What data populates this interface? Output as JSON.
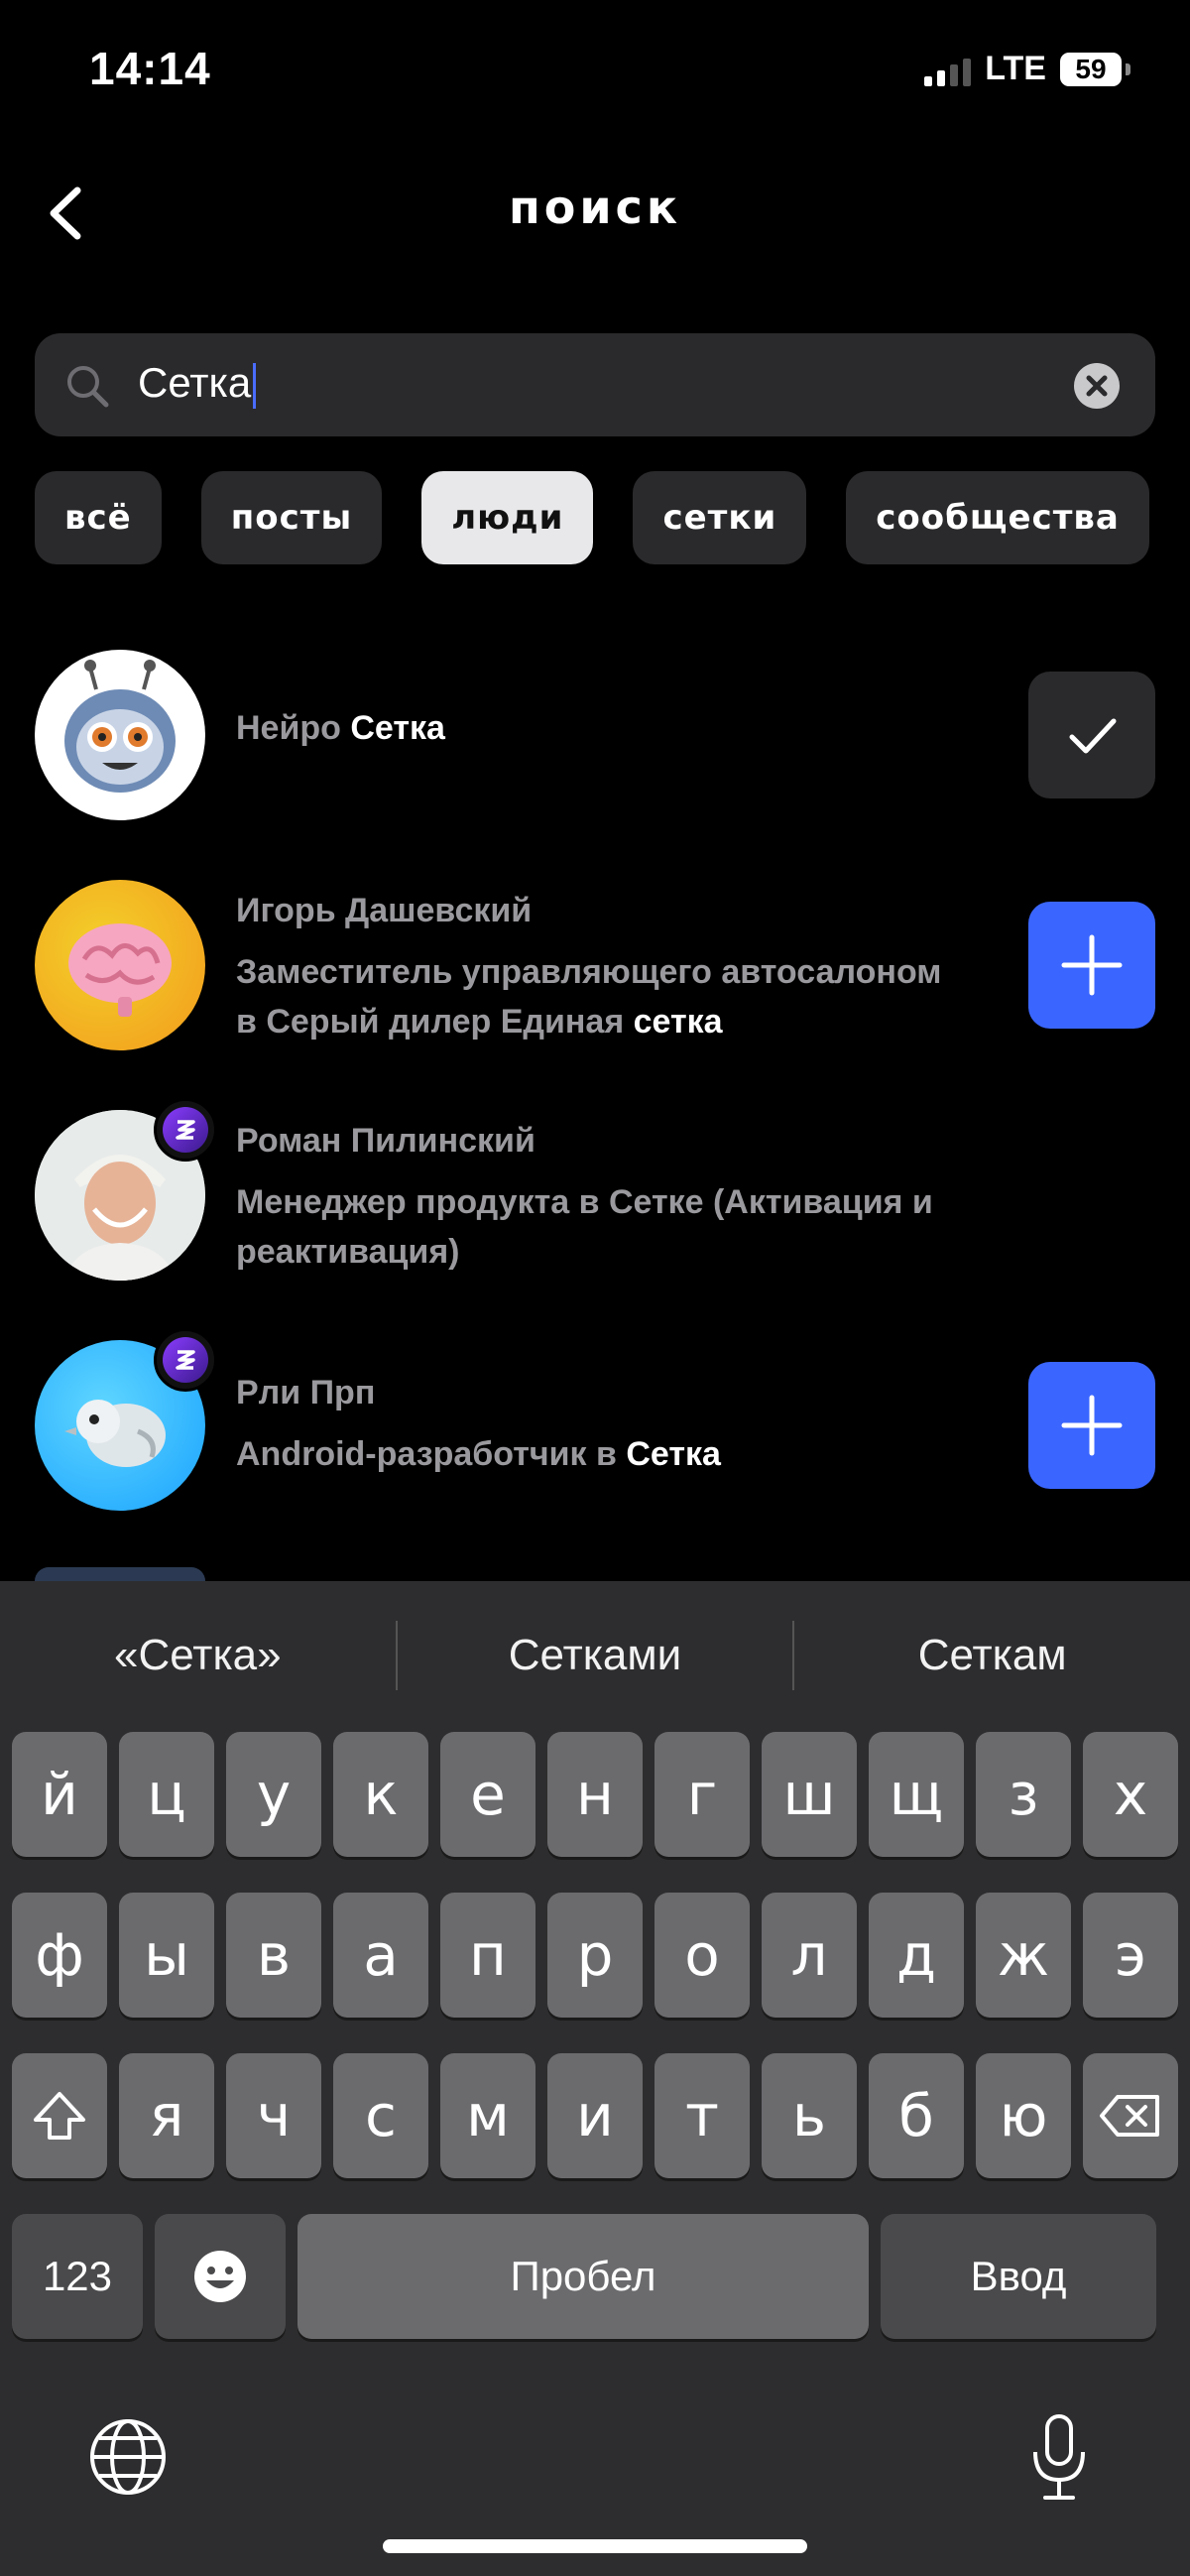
{
  "status_bar": {
    "time": "14:14",
    "network": "LTE",
    "battery": "59"
  },
  "header": {
    "title": "поиск"
  },
  "search": {
    "value": "Сетка"
  },
  "tabs": [
    {
      "label": "всё"
    },
    {
      "label": "посты"
    },
    {
      "label": "люди"
    },
    {
      "label": "сетки"
    },
    {
      "label": "сообщества"
    }
  ],
  "active_tab": "люди",
  "results": [
    {
      "name_prefix": "Нейро ",
      "name_highlight": "Сетка",
      "action": "added"
    },
    {
      "name": "Игорь Дашевский",
      "desc_line1": "Заместитель управляющего автосалоном",
      "desc_line2_prefix": "в Серый дилер Единая ",
      "desc_highlight": "сетка",
      "action": "add"
    },
    {
      "name": "Роман Пилинский",
      "desc_line1": "Менеджер продукта в Сетке (Активация и",
      "desc_line2": "реактивация)",
      "action": "none"
    },
    {
      "name": "Рли Прп",
      "desc_prefix": "Android-разработчик в ",
      "desc_highlight": "Сетка",
      "action": "add"
    }
  ],
  "keyboard": {
    "suggestions": [
      "«Сетка»",
      "Сетками",
      "Сеткам"
    ],
    "row1": [
      "й",
      "ц",
      "у",
      "к",
      "е",
      "н",
      "г",
      "ш",
      "щ",
      "з",
      "х"
    ],
    "row2": [
      "ф",
      "ы",
      "в",
      "а",
      "п",
      "р",
      "о",
      "л",
      "д",
      "ж",
      "э"
    ],
    "row3": [
      "я",
      "ч",
      "с",
      "м",
      "и",
      "т",
      "ь",
      "б",
      "ю"
    ],
    "numbers_key": "123",
    "space_key": "Пробел",
    "return_key": "Ввод"
  },
  "colors": {
    "accent": "#3a66ff",
    "background": "#000000",
    "chip": "#2a2a2c",
    "chip_active": "#e8e8ea"
  }
}
